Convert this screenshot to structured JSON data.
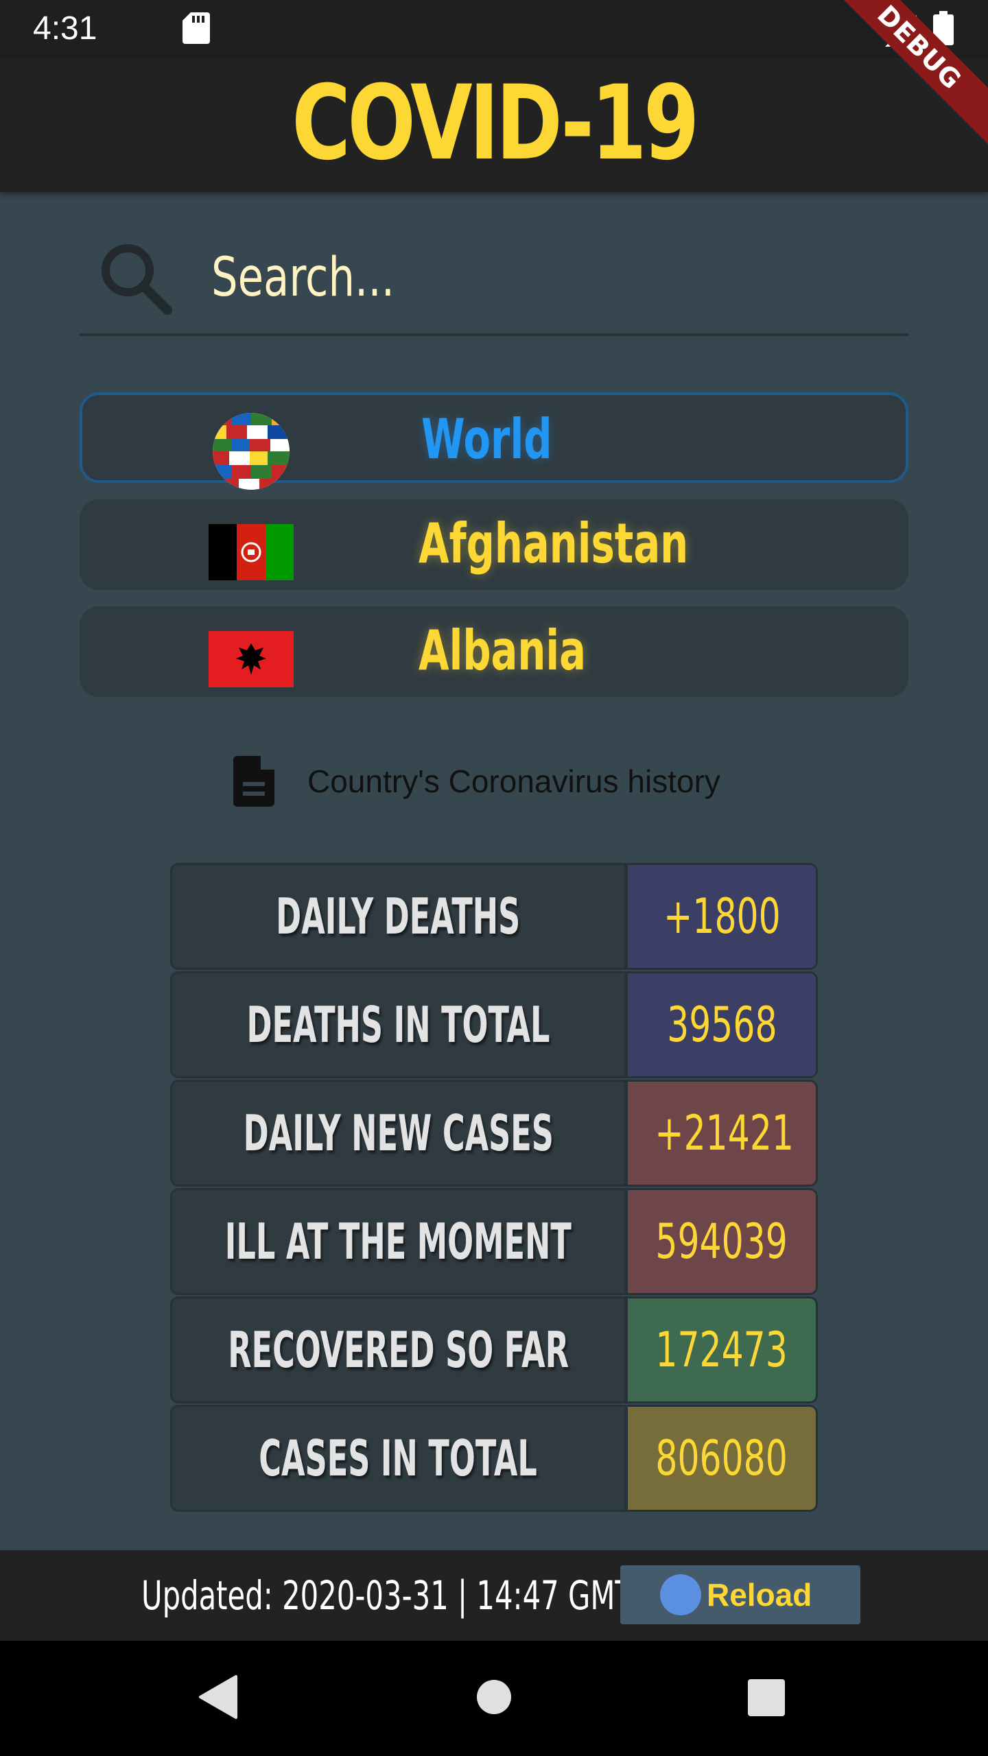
{
  "status_bar": {
    "time": "4:31",
    "debug_label": "DEBUG"
  },
  "app_bar": {
    "title": "COVID-19"
  },
  "search": {
    "placeholder": "Search...",
    "icon": "search-icon"
  },
  "countries": [
    {
      "name": "World",
      "flag": "world-globe-icon",
      "selected": true
    },
    {
      "name": "Afghanistan",
      "flag": "afghanistan-flag-icon",
      "selected": false
    },
    {
      "name": "Albania",
      "flag": "albania-flag-icon",
      "selected": false
    }
  ],
  "history": {
    "label": "Country's Coronavirus history",
    "icon": "document-icon"
  },
  "stats": [
    {
      "label": "DAILY DEATHS",
      "value": "+1800",
      "color": "#3b3f65"
    },
    {
      "label": "DEATHS IN TOTAL",
      "value": "39568",
      "color": "#3b3f65"
    },
    {
      "label": "DAILY NEW CASES",
      "value": "+21421",
      "color": "#6e4649"
    },
    {
      "label": "ILL AT THE MOMENT",
      "value": "594039",
      "color": "#6e4649"
    },
    {
      "label": "RECOVERED SO FAR",
      "value": "172473",
      "color": "#3e6a50"
    },
    {
      "label": "CASES IN TOTAL",
      "value": "806080",
      "color": "#776d3a"
    }
  ],
  "footer": {
    "updated": "Updated: 2020-03-31 | 14:47 GMT",
    "reload_label": "Reload"
  },
  "colors": {
    "accent": "#fdd835",
    "selected": "#2196f3",
    "background": "#37474f",
    "app_bar": "#222222"
  }
}
